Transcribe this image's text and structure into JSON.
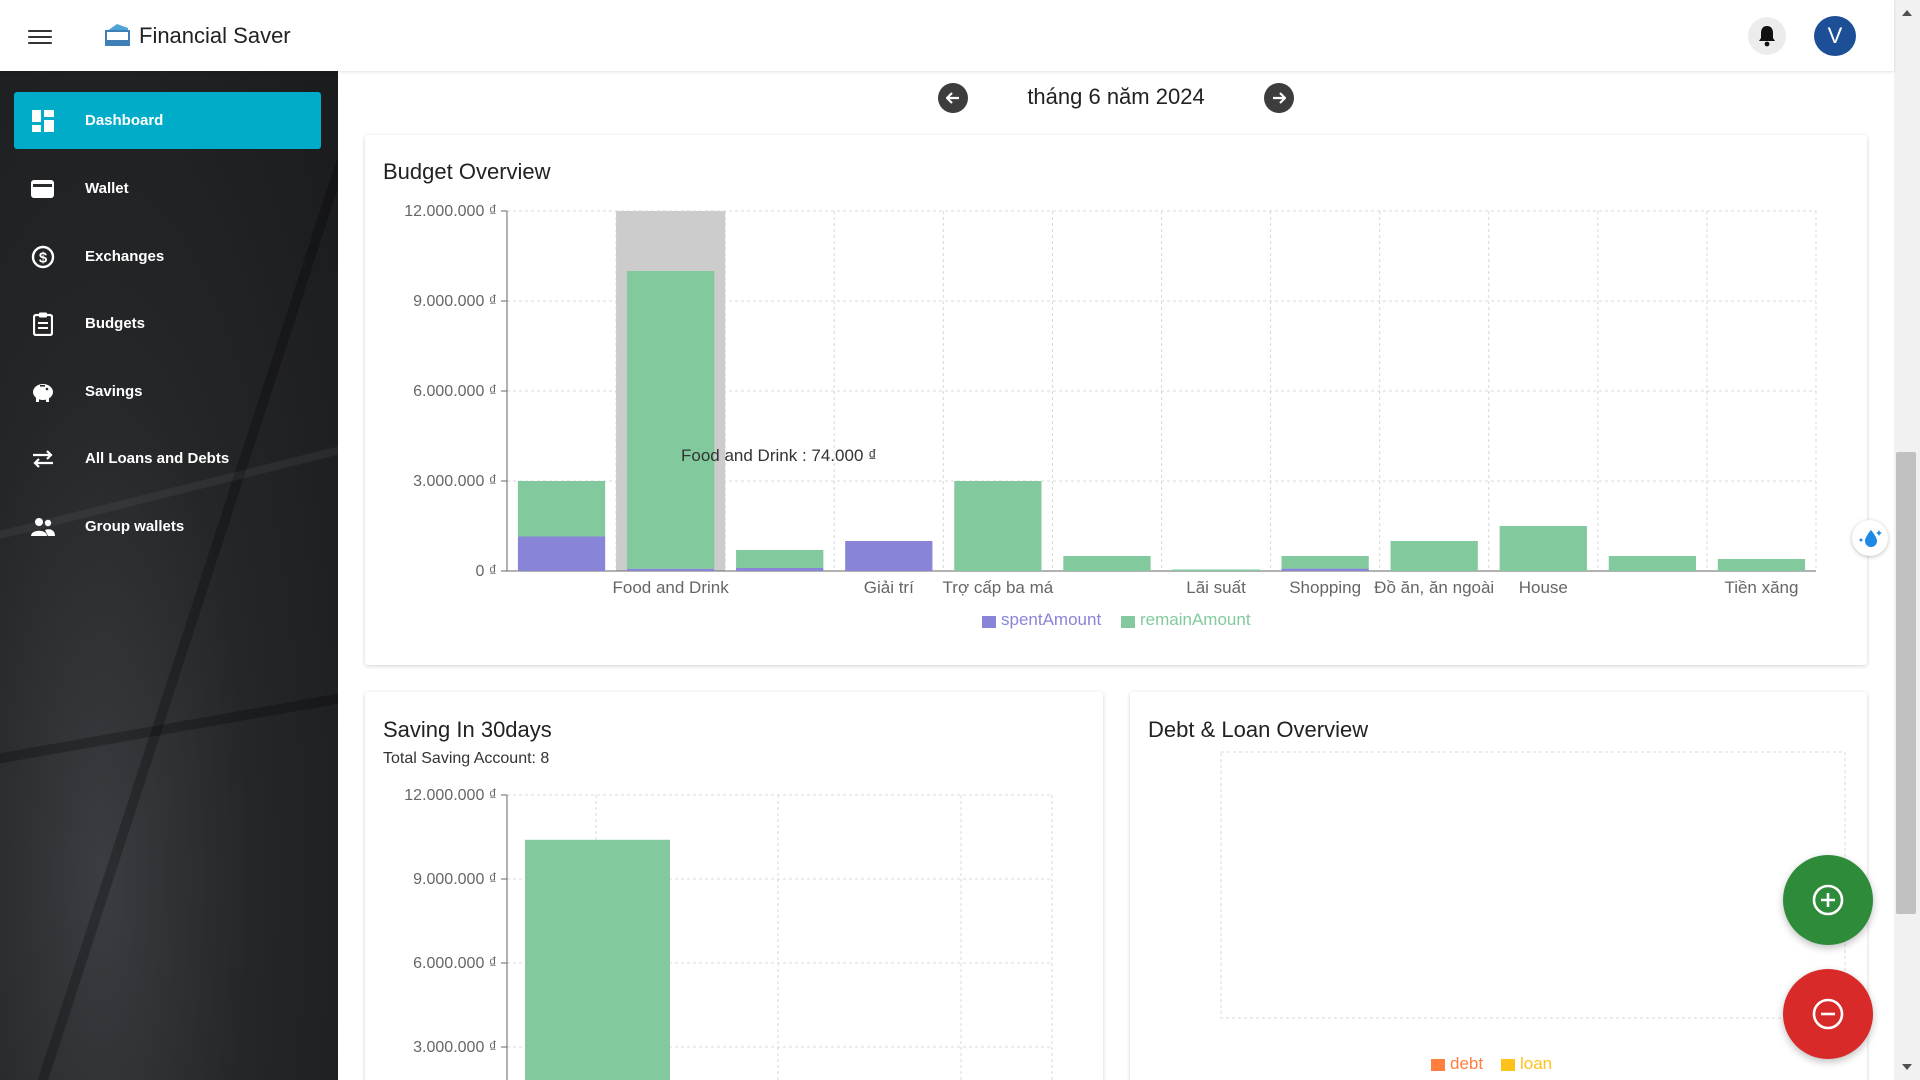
{
  "app": {
    "title": "Financial Saver",
    "avatar_letter": "V"
  },
  "sidebar": {
    "items": [
      {
        "label": "Dashboard",
        "icon": "dashboard-icon",
        "active": true
      },
      {
        "label": "Wallet",
        "icon": "wallet-icon"
      },
      {
        "label": "Exchanges",
        "icon": "exchange-icon"
      },
      {
        "label": "Budgets",
        "icon": "clipboard-icon"
      },
      {
        "label": "Savings",
        "icon": "piggy-bank-icon"
      },
      {
        "label": "All Loans and Debts",
        "icon": "swap-arrows-icon"
      },
      {
        "label": "Group wallets",
        "icon": "people-icon"
      }
    ]
  },
  "date_nav": {
    "label": "tháng 6 năm 2024"
  },
  "budget": {
    "title": "Budget Overview",
    "tooltip": "Food and Drink : 74.000 ₫",
    "legend": {
      "spent": "spentAmount",
      "remain": "remainAmount"
    }
  },
  "saving": {
    "title": "Saving In 30days",
    "subtitle": "Total Saving Account: 8"
  },
  "debt": {
    "title": "Debt & Loan Overview",
    "legend": {
      "debt": "debt",
      "loan": "loan"
    }
  },
  "colors": {
    "spent": "#8884d8",
    "remain": "#82ca9d",
    "debt": "#ff7f3f",
    "loan": "#ffc21a",
    "accent": "#00acc8",
    "fab_add": "#2e8b3a",
    "fab_remove": "#d92a2a"
  },
  "chart_data": [
    {
      "type": "bar",
      "title": "Budget Overview",
      "stacked": true,
      "ylim": [
        0,
        12000000
      ],
      "yticks": [
        "0 ₫",
        "3.000.000 ₫",
        "6.000.000 ₫",
        "9.000.000 ₫",
        "12.000.000 ₫"
      ],
      "categories": [
        "",
        "Food and Drink",
        "",
        "Giải trí",
        "Trợ cấp ba má",
        "",
        "Lãi suất",
        "Shopping",
        "Đồ ăn, ăn ngoài",
        "House",
        "",
        "Tiền xăng"
      ],
      "series": [
        {
          "name": "spentAmount",
          "values": [
            1150000,
            74000,
            100000,
            1000000,
            0,
            0,
            0,
            80000,
            0,
            0,
            0,
            0
          ]
        },
        {
          "name": "remainAmount",
          "values": [
            1850000,
            9926000,
            600000,
            0,
            3000000,
            500000,
            50000,
            420000,
            1000000,
            1500000,
            500000,
            400000
          ]
        }
      ],
      "highlight_category_index": 1,
      "legend_position": "bottom",
      "grid": true
    },
    {
      "type": "bar",
      "title": "Saving In 30days",
      "ylim": [
        0,
        12000000
      ],
      "yticks": [
        "3.000.000 ₫",
        "6.000.000 ₫",
        "9.000.000 ₫",
        "12.000.000 ₫"
      ],
      "categories": [
        "",
        "",
        ""
      ],
      "values": [
        10400000,
        0,
        0
      ],
      "grid": true
    },
    {
      "type": "bar",
      "title": "Debt & Loan Overview",
      "series": [
        {
          "name": "debt",
          "values": []
        },
        {
          "name": "loan",
          "values": []
        }
      ],
      "legend_position": "bottom",
      "grid": true
    }
  ]
}
